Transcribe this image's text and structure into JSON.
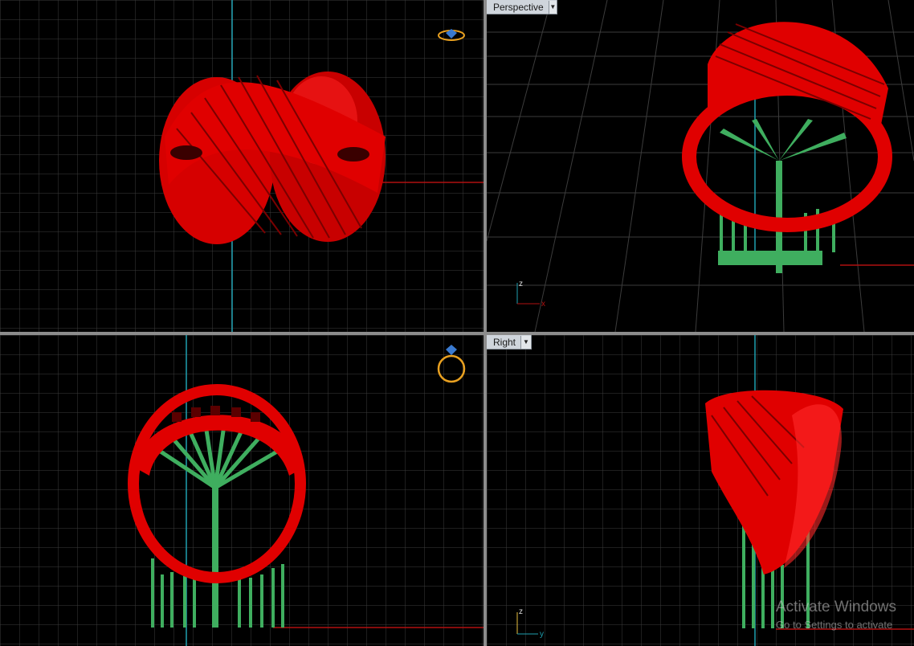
{
  "viewports": {
    "top": {
      "label": ""
    },
    "perspective": {
      "label": "Perspective"
    },
    "front": {
      "label": ""
    },
    "right": {
      "label": "Right"
    }
  },
  "axis_labels": {
    "z": "z",
    "x": "x",
    "y": "y"
  },
  "watermark": {
    "line1": "Activate Windows",
    "line2": "Go to Settings to activate"
  },
  "colors": {
    "background": "#000000",
    "grid_minor": "#3c3c3c",
    "grid_major": "#6a6a6a",
    "axis_x": "#b01010",
    "axis_y": "#1f9fb0",
    "model": "#e00000",
    "supports": "#3fae5f",
    "divider": "#8c8c8c"
  },
  "icons": [
    "ring-icon",
    "dropdown-arrow-icon"
  ]
}
